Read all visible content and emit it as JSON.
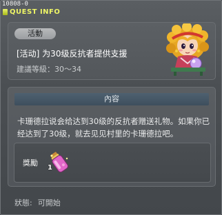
{
  "window": {
    "id_label": "10808-0",
    "title": "QUEST INFO"
  },
  "quest": {
    "tag": "活動",
    "name": "[活动] 为30级反抗者提供支援",
    "level_label": "建議等級：",
    "level_range": "30～34"
  },
  "content": {
    "header": "內容",
    "text": "卡珊德拉说会给达到30级的反抗者赠送礼物。如果你已经达到了30级，就去见见村里的卡珊德拉吧。",
    "reward_label": "獎勵",
    "reward_quantity": "1"
  },
  "status": {
    "label": "狀態:",
    "value": "可開始"
  },
  "icons": {
    "avatar": "npc-cassandra-portrait",
    "reward": "pink-potion-bottle-icon"
  },
  "colors": {
    "title_yellow": "#eef566",
    "panel_header": "#46596a"
  }
}
